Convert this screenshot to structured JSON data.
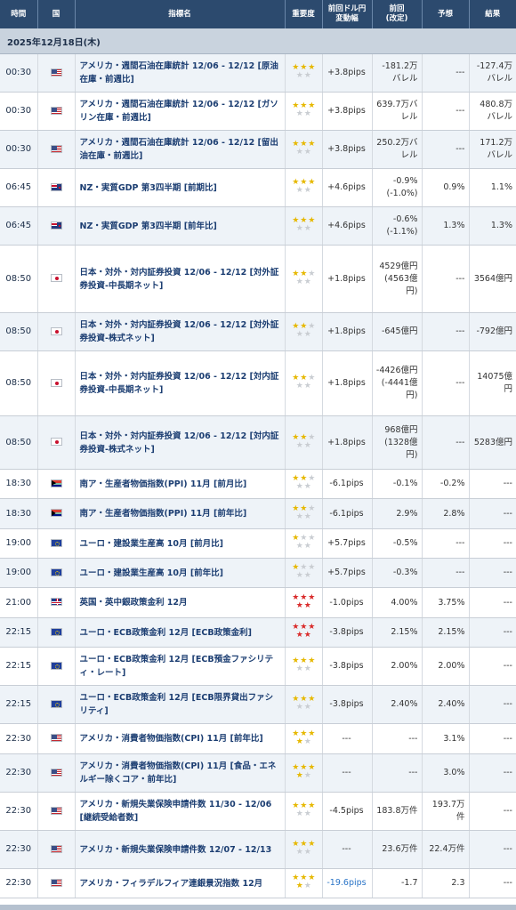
{
  "header": {
    "time": "時間",
    "country": "国",
    "indicator": "指標名",
    "importance": "重要度",
    "movement": "前回ドル円\n変動幅",
    "previous": "前回\n(改定)",
    "forecast": "予想",
    "result": "結果"
  },
  "date_label": "2025年12月18日(木)",
  "events": [
    {
      "time": "00:30",
      "flag": "us",
      "name": "アメリカ・週間石油在庫統計 12/06 - 12/12 [原油在庫・前週比]",
      "stars": 3,
      "level": "mid",
      "movement": "+3.8pips",
      "previous": "-181.2万バレル",
      "forecast": "---",
      "result": "-127.4万バレル",
      "height": 43
    },
    {
      "time": "00:30",
      "flag": "us",
      "name": "アメリカ・週間石油在庫統計 12/06 - 12/12 [ガソリン在庫・前週比]",
      "stars": 3,
      "level": "mid",
      "movement": "+3.8pips",
      "previous": "639.7万バレル",
      "forecast": "---",
      "result": "480.8万バレル",
      "height": 43
    },
    {
      "time": "00:30",
      "flag": "us",
      "name": "アメリカ・週間石油在庫統計 12/06 - 12/12 [留出油在庫・前週比]",
      "stars": 3,
      "level": "mid",
      "movement": "+3.8pips",
      "previous": "250.2万バレル",
      "forecast": "---",
      "result": "171.2万バレル",
      "height": 43
    },
    {
      "time": "06:45",
      "flag": "nz",
      "name": "NZ・実質GDP 第3四半期 [前期比]",
      "stars": 3,
      "level": "mid",
      "movement": "+4.6pips",
      "previous": "-0.9%(-1.0%)",
      "forecast": "0.9%",
      "result": "1.1%",
      "height": 43
    },
    {
      "time": "06:45",
      "flag": "nz",
      "name": "NZ・実質GDP 第3四半期 [前年比]",
      "stars": 3,
      "level": "mid",
      "movement": "+4.6pips",
      "previous": "-0.6%(-1.1%)",
      "forecast": "1.3%",
      "result": "1.3%",
      "height": 43
    },
    {
      "time": "08:50",
      "flag": "jp",
      "name": "日本・対外・対内証券投資 12/06 - 12/12 [対外証券投資-中長期ネット]",
      "stars": 2,
      "level": "mid",
      "movement": "+1.8pips",
      "previous": "4529億円(4563億円)",
      "forecast": "---",
      "result": "3564億円",
      "height": 76
    },
    {
      "time": "08:50",
      "flag": "jp",
      "name": "日本・対外・対内証券投資 12/06 - 12/12 [対外証券投資-株式ネット]",
      "stars": 2,
      "level": "mid",
      "movement": "+1.8pips",
      "previous": "-645億円",
      "forecast": "---",
      "result": "-792億円",
      "height": 43
    },
    {
      "time": "08:50",
      "flag": "jp",
      "name": "日本・対外・対内証券投資 12/06 - 12/12 [対内証券投資-中長期ネット]",
      "stars": 2,
      "level": "mid",
      "movement": "+1.8pips",
      "previous": "-4426億円(-4441億円)",
      "forecast": "---",
      "result": "14075億円",
      "height": 73
    },
    {
      "time": "08:50",
      "flag": "jp",
      "name": "日本・対外・対内証券投資 12/06 - 12/12 [対内証券投資-株式ネット]",
      "stars": 2,
      "level": "mid",
      "movement": "+1.8pips",
      "previous": "968億円(1328億円)",
      "forecast": "---",
      "result": "5283億円",
      "height": 60
    },
    {
      "time": "18:30",
      "flag": "za",
      "name": "南ア・生産者物価指数(PPI) 11月 [前月比]",
      "stars": 2,
      "level": "mid",
      "movement": "-6.1pips",
      "previous": "-0.1%",
      "forecast": "-0.2%",
      "result": "---",
      "height": 33
    },
    {
      "time": "18:30",
      "flag": "za",
      "name": "南ア・生産者物価指数(PPI) 11月 [前年比]",
      "stars": 2,
      "level": "mid",
      "movement": "-6.1pips",
      "previous": "2.9%",
      "forecast": "2.8%",
      "result": "---",
      "height": 34
    },
    {
      "time": "19:00",
      "flag": "eu",
      "name": "ユーロ・建設業生産高 10月 [前月比]",
      "stars": 1,
      "level": "mid",
      "movement": "+5.7pips",
      "previous": "-0.5%",
      "forecast": "---",
      "result": "---",
      "height": 33
    },
    {
      "time": "19:00",
      "flag": "eu",
      "name": "ユーロ・建設業生産高 10月 [前年比]",
      "stars": 1,
      "level": "mid",
      "movement": "+5.7pips",
      "previous": "-0.3%",
      "forecast": "---",
      "result": "---",
      "height": 33
    },
    {
      "time": "21:00",
      "flag": "gb",
      "name": "英国・英中銀政策金利 12月",
      "stars": 5,
      "level": "high",
      "movement": "-1.0pips",
      "previous": "4.00%",
      "forecast": "3.75%",
      "result": "---",
      "height": 34
    },
    {
      "time": "22:15",
      "flag": "eu",
      "name": "ユーロ・ECB政策金利 12月 [ECB政策金利]",
      "stars": 5,
      "level": "high",
      "movement": "-3.8pips",
      "previous": "2.15%",
      "forecast": "2.15%",
      "result": "---",
      "height": 33
    },
    {
      "time": "22:15",
      "flag": "eu",
      "name": "ユーロ・ECB政策金利 12月 [ECB預金ファシリティ・レート]",
      "stars": 3,
      "level": "mid",
      "movement": "-3.8pips",
      "previous": "2.00%",
      "forecast": "2.00%",
      "result": "---",
      "height": 43
    },
    {
      "time": "22:15",
      "flag": "eu",
      "name": "ユーロ・ECB政策金利 12月 [ECB限界貸出ファシリティ]",
      "stars": 3,
      "level": "mid",
      "movement": "-3.8pips",
      "previous": "2.40%",
      "forecast": "2.40%",
      "result": "---",
      "height": 43
    },
    {
      "time": "22:30",
      "flag": "us",
      "name": "アメリカ・消費者物価指数(CPI) 11月 [前年比]",
      "stars": 4,
      "level": "mid",
      "movement": "---",
      "previous": "---",
      "forecast": "3.1%",
      "result": "---",
      "height": 34
    },
    {
      "time": "22:30",
      "flag": "us",
      "name": "アメリカ・消費者物価指数(CPI) 11月 [食品・エネルギー除くコア・前年比]",
      "stars": 4,
      "level": "mid",
      "movement": "---",
      "previous": "---",
      "forecast": "3.0%",
      "result": "---",
      "height": 43
    },
    {
      "time": "22:30",
      "flag": "us",
      "name": "アメリカ・新規失業保険申請件数 11/30 - 12/06 [継続受給者数]",
      "stars": 3,
      "level": "mid",
      "movement": "-4.5pips",
      "previous": "183.8万件",
      "forecast": "193.7万件",
      "result": "---",
      "height": 43
    },
    {
      "time": "22:30",
      "flag": "us",
      "name": "アメリカ・新規失業保険申請件数 12/07 - 12/13",
      "stars": 3,
      "level": "mid",
      "movement": "---",
      "previous": "23.6万件",
      "forecast": "22.4万件",
      "result": "---",
      "height": 43
    },
    {
      "time": "22:30",
      "flag": "us",
      "name": "アメリカ・フィラデルフィア連銀景況指数 12月",
      "stars": 4,
      "level": "mid",
      "movement": "-19.6pips",
      "previous": "-1.7",
      "forecast": "2.3",
      "result": "---",
      "height": 33
    }
  ]
}
